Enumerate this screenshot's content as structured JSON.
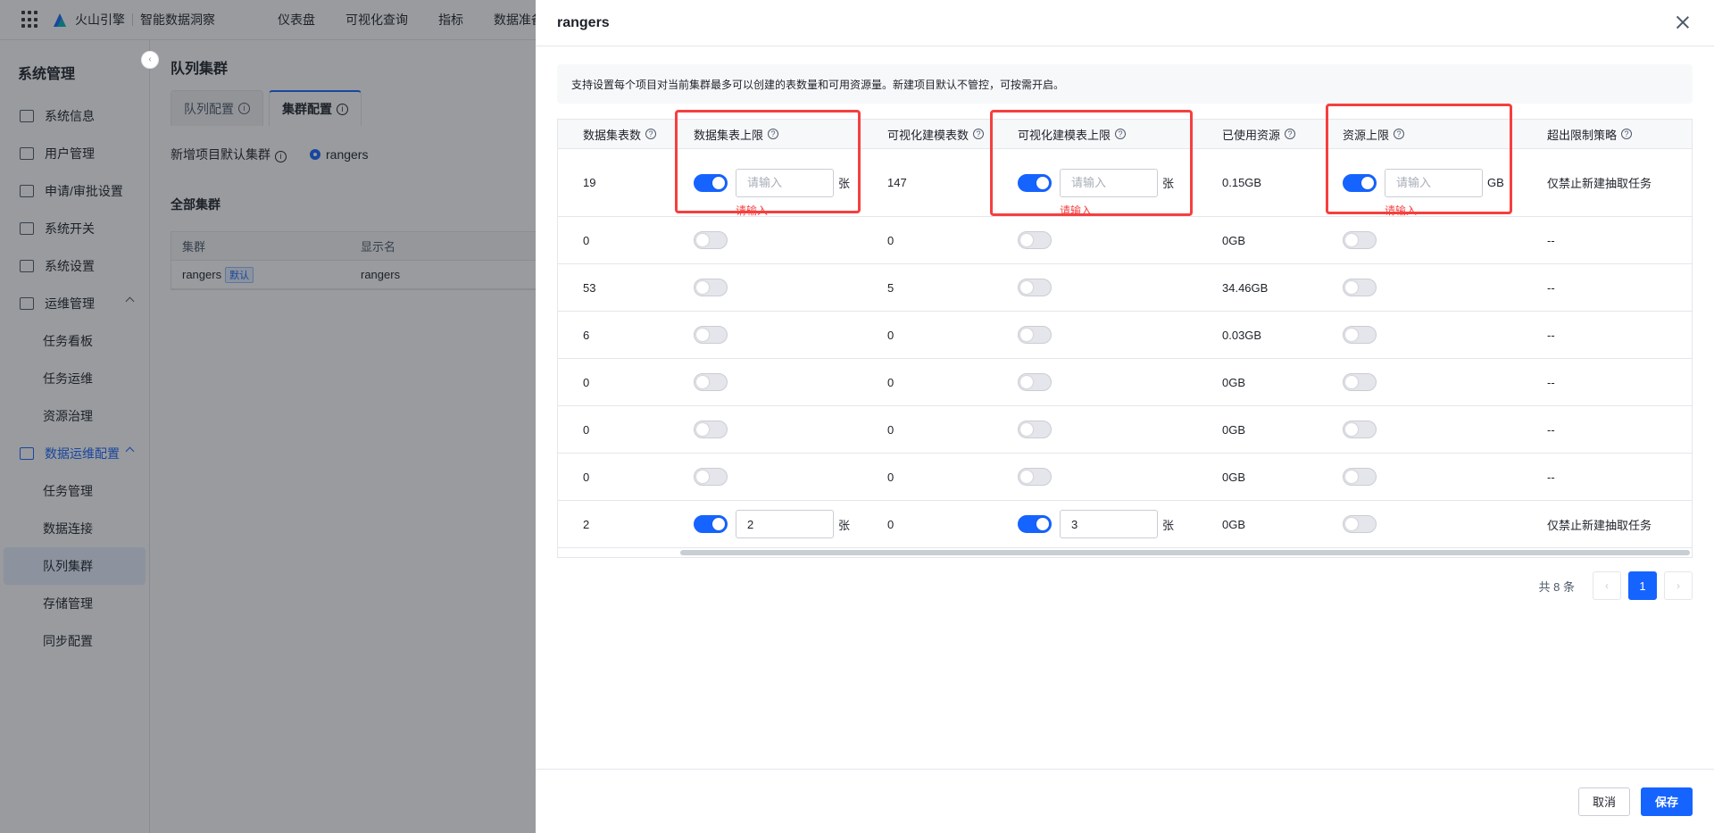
{
  "app": {
    "brand": "火山引擎",
    "product": "智能数据洞察",
    "nav": [
      "仪表盘",
      "可视化查询",
      "指标",
      "数据准备"
    ]
  },
  "sidebar": {
    "title": "系统管理",
    "items": [
      {
        "label": "系统信息",
        "icon": "info-panel-icon"
      },
      {
        "label": "用户管理",
        "icon": "users-icon"
      },
      {
        "label": "申请/审批设置",
        "icon": "approval-icon"
      },
      {
        "label": "系统开关",
        "icon": "switches-icon"
      },
      {
        "label": "系统设置",
        "icon": "gear-icon"
      },
      {
        "label": "运维管理",
        "icon": "monitor-icon"
      },
      {
        "label": "任务看板"
      },
      {
        "label": "任务运维"
      },
      {
        "label": "资源治理"
      },
      {
        "label": "数据运维配置",
        "icon": "data-ops-icon"
      },
      {
        "label": "任务管理"
      },
      {
        "label": "数据连接"
      },
      {
        "label": "队列集群"
      },
      {
        "label": "存储管理"
      },
      {
        "label": "同步配置"
      }
    ]
  },
  "main": {
    "title": "队列集群",
    "tabs": [
      "队列配置",
      "集群配置"
    ],
    "default_label": "新增项目默认集群",
    "default_value": "rangers",
    "section_title": "全部集群",
    "table_headers": [
      "集群",
      "显示名"
    ],
    "row": {
      "cluster": "rangers",
      "tag": "默认",
      "display": "rangers"
    }
  },
  "drawer": {
    "title": "rangers",
    "notice": "支持设置每个项目对当前集群最多可以创建的表数量和可用资源量。新建项目默认不管控，可按需开启。",
    "headers": [
      "数据集表数",
      "数据集表上限",
      "可视化建模表数",
      "可视化建模表上限",
      "已使用资源",
      "资源上限",
      "超出限制策略"
    ],
    "placeholder": "请输入",
    "error_text": "请输入",
    "unit_table": "张",
    "unit_gb": "GB",
    "rows": [
      {
        "dataset_count": "19",
        "dataset_on": true,
        "dataset_limit": "",
        "model_count": "147",
        "model_on": true,
        "model_limit": "",
        "used": "0.15GB",
        "res_on": true,
        "res_limit": "",
        "policy": "仅禁止新建抽取任务",
        "error": true
      },
      {
        "dataset_count": "0",
        "dataset_on": false,
        "model_count": "0",
        "model_on": false,
        "used": "0GB",
        "res_on": false,
        "policy": "--"
      },
      {
        "dataset_count": "53",
        "dataset_on": false,
        "model_count": "5",
        "model_on": false,
        "used": "34.46GB",
        "res_on": false,
        "policy": "--"
      },
      {
        "dataset_count": "6",
        "dataset_on": false,
        "model_count": "0",
        "model_on": false,
        "used": "0.03GB",
        "res_on": false,
        "policy": "--"
      },
      {
        "dataset_count": "0",
        "dataset_on": false,
        "model_count": "0",
        "model_on": false,
        "used": "0GB",
        "res_on": false,
        "policy": "--"
      },
      {
        "dataset_count": "0",
        "dataset_on": false,
        "model_count": "0",
        "model_on": false,
        "used": "0GB",
        "res_on": false,
        "policy": "--"
      },
      {
        "dataset_count": "0",
        "dataset_on": false,
        "model_count": "0",
        "model_on": false,
        "used": "0GB",
        "res_on": false,
        "policy": "--"
      },
      {
        "dataset_count": "2",
        "dataset_on": true,
        "dataset_limit": "2",
        "model_count": "0",
        "model_on": true,
        "model_limit": "3",
        "used": "0GB",
        "res_on": false,
        "policy": "仅禁止新建抽取任务"
      }
    ],
    "pagination": {
      "total": "共 8 条",
      "current": "1"
    },
    "cancel_label": "取消",
    "save_label": "保存"
  },
  "colors": {
    "primary": "#1664ff",
    "error": "#f53f3f",
    "highlight": "#f53f3f"
  }
}
